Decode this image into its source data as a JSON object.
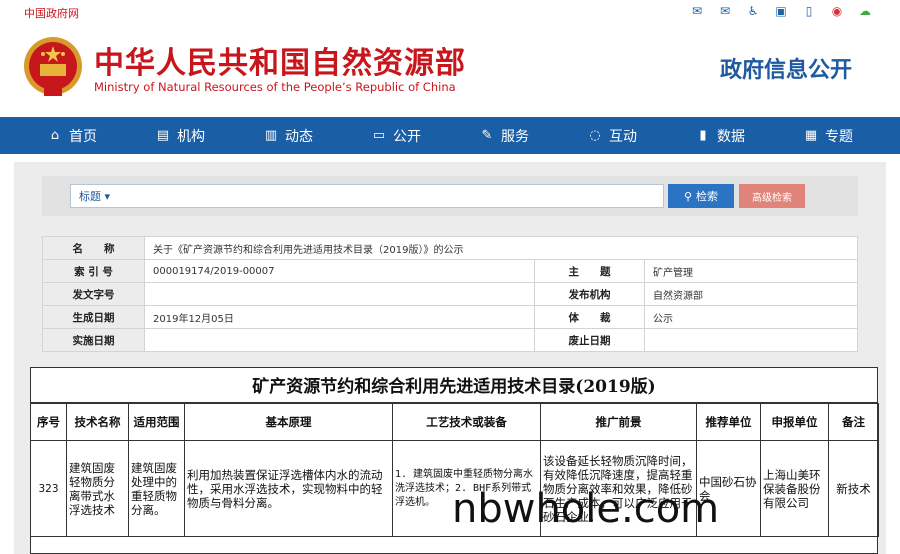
{
  "topbar": {
    "gov_link": "中国政府网"
  },
  "header": {
    "title_cn": "中华人民共和国自然资源部",
    "title_en": "Ministry of Natural Resources of the People’s Republic of China",
    "gov_info": "政府信息公开"
  },
  "nav": [
    {
      "label": "首页",
      "icon": "home-icon"
    },
    {
      "label": "机构",
      "icon": "org-icon"
    },
    {
      "label": "动态",
      "icon": "news-icon"
    },
    {
      "label": "公开",
      "icon": "public-icon"
    },
    {
      "label": "服务",
      "icon": "service-icon"
    },
    {
      "label": "互动",
      "icon": "chat-icon"
    },
    {
      "label": "数据",
      "icon": "data-icon"
    },
    {
      "label": "专题",
      "icon": "topic-icon"
    }
  ],
  "search": {
    "select_label": "标题",
    "search_label": "检索",
    "advanced_label": "高级检索"
  },
  "meta": {
    "name_key": "名　　称",
    "name_val": "关于《矿产资源节约和综合利用先进适用技术目录（2019版）》的公示",
    "index_key": "索 引 号",
    "index_val": "000019174/2019-00007",
    "subject_key": "主　　题",
    "subject_val": "矿产管理",
    "doc_no_key": "发文字号",
    "doc_no_val": "",
    "issuer_key": "发布机构",
    "issuer_val": "自然资源部",
    "date_key": "生成日期",
    "date_val": "2019年12月05日",
    "genre_key": "体　　裁",
    "genre_val": "公示",
    "impl_key": "实施日期",
    "impl_val": "",
    "expire_key": "废止日期",
    "expire_val": ""
  },
  "catalog": {
    "title": "矿产资源节约和综合利用先进适用技术目录(2019版)",
    "headers": [
      "序号",
      "技术名称",
      "适用范围",
      "基本原理",
      "工艺技术或装备",
      "推广前景",
      "推荐单位",
      "申报单位",
      "备注"
    ],
    "row": {
      "no": "323",
      "name": "建筑固废轻物质分离带式水浮选技术",
      "scope": "建筑固废处理中的重轻质物分离。",
      "principle": "利用加热装置保证浮选槽体内水的流动性，采用水浮选技术，实现物料中的轻物质与骨料分离。",
      "process": "1. 建筑固废中重轻质物分离水洗浮选技术；2. BHF系列带式浮选机。",
      "prospect": "该设备延长轻物质沉降时间，有效降低沉降速度，提高轻重物质分离效率和效果，降低砂石生产成本，可以广泛应用于砂石企业。",
      "recommender": "中国砂石协会",
      "applicant": "上海山美环保装备股份有限公司",
      "note": "新技术"
    }
  },
  "watermark": "nbwhole.com",
  "colors": {
    "brand_red": "#c8161d",
    "nav_blue": "#1a5ea6",
    "search_blue": "#2b74c4",
    "advanced_pink": "#e0837a"
  }
}
